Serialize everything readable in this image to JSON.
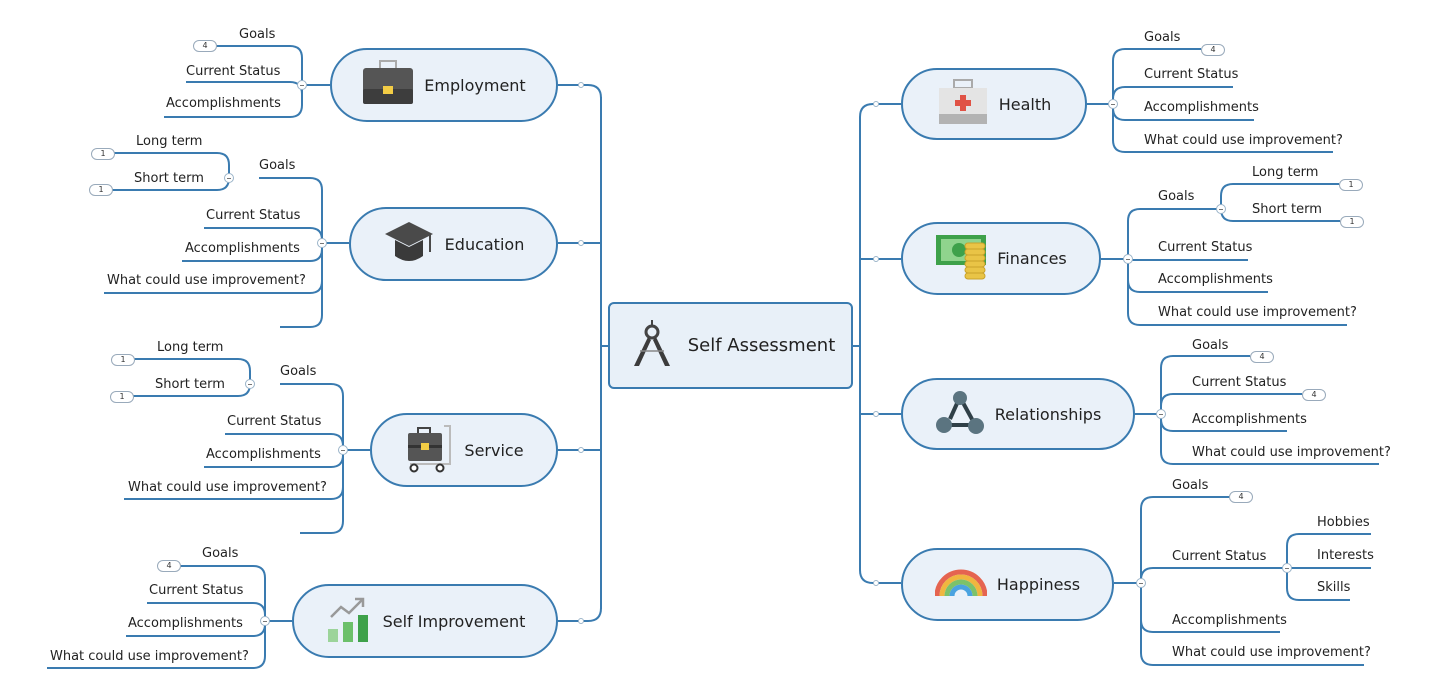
{
  "colors": {
    "line": "#3a7bb0",
    "node_fill": "#eaf1f9",
    "node_border": "#3a7bb0"
  },
  "central": {
    "label": "Self Assessment",
    "icon": "drafting-compass-icon"
  },
  "branches": [
    {
      "key": "employment",
      "label": "Employment",
      "icon": "briefcase-icon",
      "side": "left",
      "children": [
        {
          "label": "Goals",
          "badge": "4"
        },
        {
          "label": "Current Status"
        },
        {
          "label": "Accomplishments"
        }
      ]
    },
    {
      "key": "education",
      "label": "Education",
      "icon": "graduation-cap-icon",
      "side": "left",
      "children": [
        {
          "label": "Goals",
          "children": [
            {
              "label": "Long term",
              "badge": "1"
            },
            {
              "label": "Short term",
              "badge": "1"
            }
          ]
        },
        {
          "label": "Current Status"
        },
        {
          "label": "Accomplishments"
        },
        {
          "label": "What could use improvement?"
        },
        {
          "label": ""
        }
      ]
    },
    {
      "key": "service",
      "label": "Service",
      "icon": "luggage-cart-icon",
      "side": "left",
      "children": [
        {
          "label": "Goals",
          "children": [
            {
              "label": "Long term",
              "badge": "1"
            },
            {
              "label": "Short term",
              "badge": "1"
            }
          ]
        },
        {
          "label": "Current Status"
        },
        {
          "label": "Accomplishments"
        },
        {
          "label": "What could use improvement?"
        },
        {
          "label": ""
        }
      ]
    },
    {
      "key": "self_improvement",
      "label": "Self Improvement",
      "icon": "growth-chart-icon",
      "side": "left",
      "children": [
        {
          "label": "Goals",
          "badge": "4"
        },
        {
          "label": "Current Status"
        },
        {
          "label": "Accomplishments"
        },
        {
          "label": "What could use improvement?"
        }
      ]
    },
    {
      "key": "health",
      "label": "Health",
      "icon": "first-aid-kit-icon",
      "side": "right",
      "children": [
        {
          "label": "Goals",
          "badge": "4"
        },
        {
          "label": "Current Status"
        },
        {
          "label": "Accomplishments"
        },
        {
          "label": "What could use improvement?"
        }
      ]
    },
    {
      "key": "finances",
      "label": "Finances",
      "icon": "money-coins-icon",
      "side": "right",
      "children": [
        {
          "label": "Goals",
          "children": [
            {
              "label": "Long term",
              "badge": "1"
            },
            {
              "label": "Short term",
              "badge": "1"
            }
          ]
        },
        {
          "label": "Current Status"
        },
        {
          "label": "Accomplishments"
        },
        {
          "label": "What could use improvement?"
        }
      ]
    },
    {
      "key": "relationships",
      "label": "Relationships",
      "icon": "network-triangle-icon",
      "side": "right",
      "children": [
        {
          "label": "Goals",
          "badge": "4"
        },
        {
          "label": "Current Status",
          "badge": "4"
        },
        {
          "label": "Accomplishments"
        },
        {
          "label": "What could use improvement?"
        }
      ]
    },
    {
      "key": "happiness",
      "label": "Happiness",
      "icon": "rainbow-icon",
      "side": "right",
      "children": [
        {
          "label": "Goals",
          "badge": "4"
        },
        {
          "label": "Current Status",
          "children": [
            {
              "label": "Hobbies"
            },
            {
              "label": "Interests"
            },
            {
              "label": "Skills"
            }
          ]
        },
        {
          "label": "Accomplishments"
        },
        {
          "label": "What could use improvement?"
        }
      ]
    }
  ]
}
